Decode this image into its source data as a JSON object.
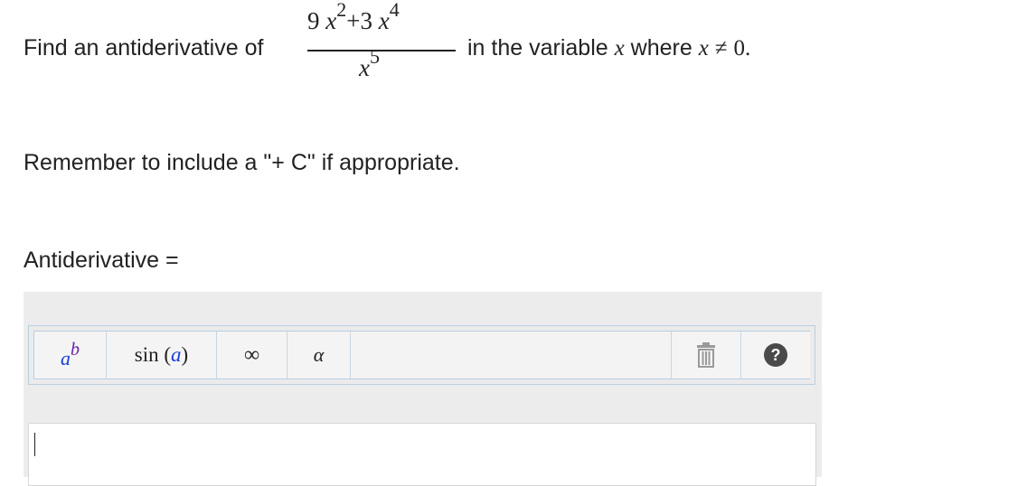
{
  "question": {
    "prefix": "Find an antiderivative of",
    "fraction": {
      "num_coef1": "9",
      "num_var1": "x",
      "num_exp1": "2",
      "num_plus": "+3",
      "num_var2": "x",
      "num_exp2": "4",
      "den_var": "x",
      "den_exp": "5"
    },
    "mid_text": "in the variable",
    "var": "x",
    "where_text": "where",
    "condition_var": "x",
    "condition_op": "≠",
    "condition_val": "0",
    "period": "."
  },
  "reminder": "Remember to include a \"+ C\" if appropriate.",
  "answer_label": "Antiderivative =",
  "toolbar": {
    "exponent_base": "a",
    "exponent_power": "b",
    "function_name": "sin",
    "function_arg": "a",
    "infinity": "∞",
    "greek": "α",
    "help": "?"
  },
  "colors": {
    "exponent_base": "#1a3fd6",
    "exponent_power": "#6a1fa6",
    "function_arg": "#1a3fd6",
    "help_bg": "#4a4a4a"
  },
  "input": {
    "value": ""
  }
}
